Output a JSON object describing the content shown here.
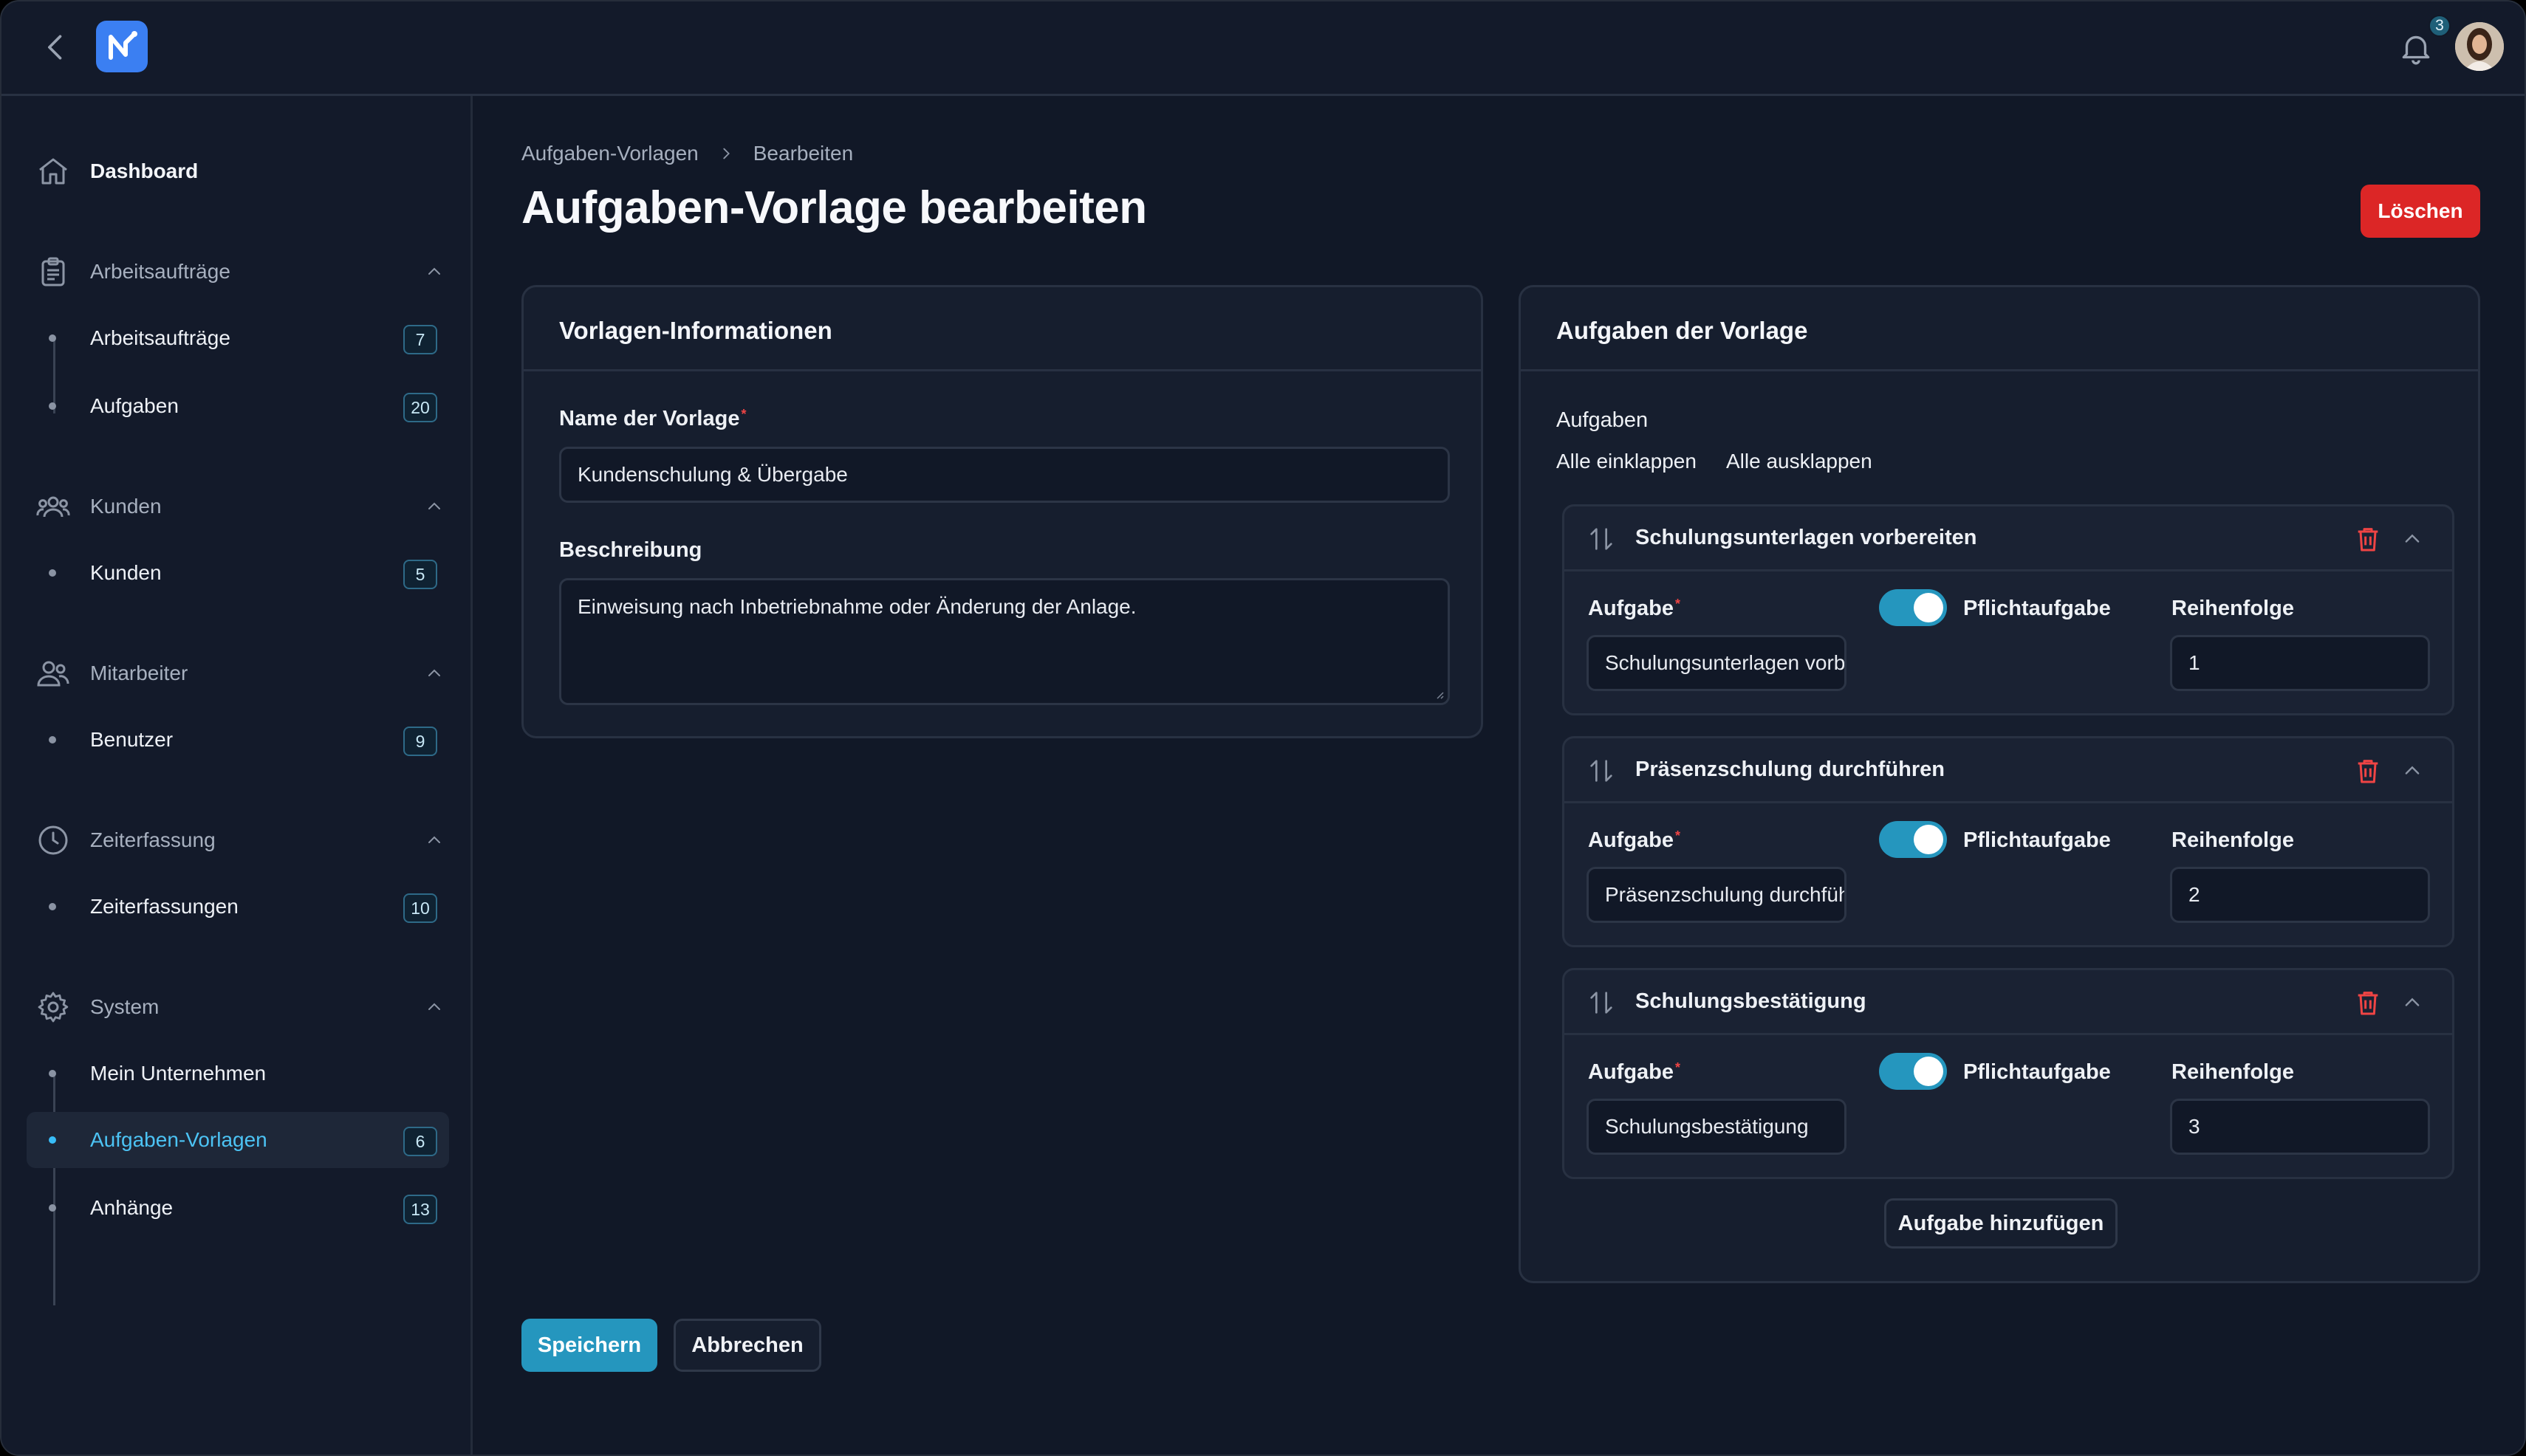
{
  "topbar": {
    "notification_count": "3"
  },
  "sidebar": {
    "dashboard": "Dashboard",
    "groups": [
      {
        "label": "Arbeitsaufträge",
        "items": [
          {
            "label": "Arbeitsaufträge",
            "count": "7"
          },
          {
            "label": "Aufgaben",
            "count": "20"
          }
        ]
      },
      {
        "label": "Kunden",
        "items": [
          {
            "label": "Kunden",
            "count": "5"
          }
        ]
      },
      {
        "label": "Mitarbeiter",
        "items": [
          {
            "label": "Benutzer",
            "count": "9"
          }
        ]
      },
      {
        "label": "Zeiterfassung",
        "items": [
          {
            "label": "Zeiterfassungen",
            "count": "10"
          }
        ]
      },
      {
        "label": "System",
        "items": [
          {
            "label": "Mein Unternehmen",
            "count": ""
          },
          {
            "label": "Aufgaben-Vorlagen",
            "count": "6"
          },
          {
            "label": "Anhänge",
            "count": "13"
          }
        ]
      }
    ]
  },
  "breadcrumb": [
    "Aufgaben-Vorlagen",
    "Bearbeiten"
  ],
  "page_title": "Aufgaben-Vorlage bearbeiten",
  "delete_label": "Löschen",
  "info_card": {
    "title": "Vorlagen-Informationen",
    "name_label": "Name der Vorlage",
    "name_value": "Kundenschulung & Übergabe",
    "desc_label": "Beschreibung",
    "desc_value": "Einweisung nach Inbetriebnahme oder Änderung der Anlage."
  },
  "tasks_card": {
    "title": "Aufgaben der Vorlage",
    "section_label": "Aufgaben",
    "collapse_all": "Alle einklappen",
    "expand_all": "Alle ausklappen",
    "field_task": "Aufgabe",
    "field_required": "Pflichtaufgabe",
    "field_order": "Reihenfolge",
    "tasks": [
      {
        "name": "Schulungsunterlagen vorbereiten",
        "value": "Schulungsunterlagen vorbereiten",
        "order": "1",
        "required": true
      },
      {
        "name": "Präsenzschulung durchführen",
        "value": "Präsenzschulung durchführen",
        "order": "2",
        "required": true
      },
      {
        "name": "Schulungsbestätigung",
        "value": "Schulungsbestätigung",
        "order": "3",
        "required": true
      }
    ],
    "add_task": "Aufgabe hinzufügen"
  },
  "footer": {
    "save": "Speichern",
    "cancel": "Abbrechen"
  }
}
